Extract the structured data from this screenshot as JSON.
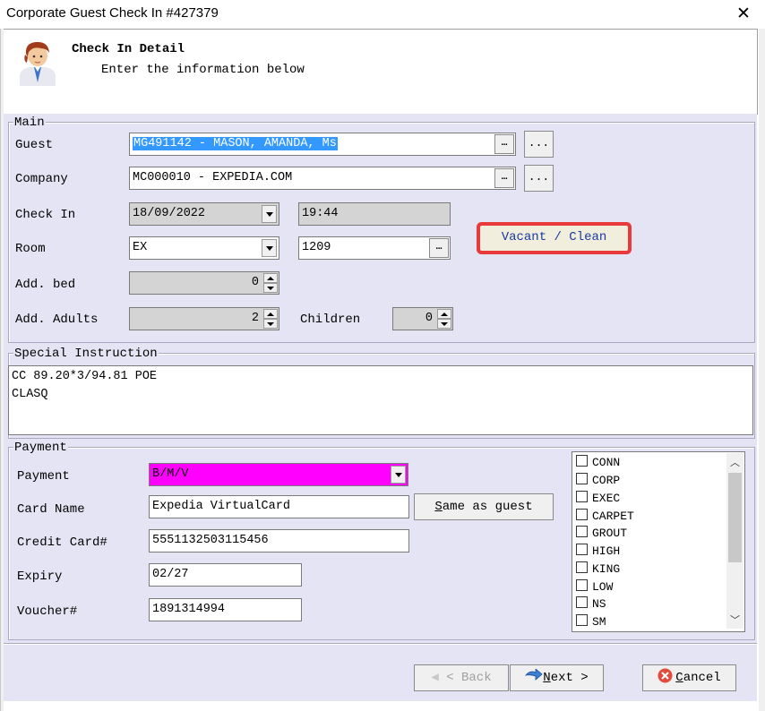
{
  "window": {
    "title": "Corporate Guest Check In #427379",
    "close_glyph": "✕"
  },
  "header": {
    "title": "Check In Detail",
    "subtitle": "Enter the information below",
    "icon": "user-avatar-icon"
  },
  "main": {
    "group_label": "Main",
    "guest": {
      "label": "Guest",
      "value": "MG491142 - MASON, AMANDA, Ms",
      "lookup_glyph": "…",
      "extra_button": "..."
    },
    "company": {
      "label": "Company",
      "value": "MC000010 - EXPEDIA.COM",
      "lookup_glyph": "…",
      "extra_button": "..."
    },
    "check_in": {
      "label": "Check In",
      "date": "18/09/2022",
      "time": "19:44"
    },
    "room": {
      "label": "Room",
      "type": "EX",
      "number": "1209",
      "lookup_glyph": "…"
    },
    "status": {
      "text": "Vacant / Clean",
      "highlight_color": "#e83a3a"
    },
    "add_bed": {
      "label": "Add. bed",
      "value": "0"
    },
    "add_adults": {
      "label": "Add. Adults",
      "value": "2"
    },
    "children": {
      "label": "Children",
      "value": "0"
    }
  },
  "special_instruction": {
    "group_label": "Special Instruction",
    "lines": [
      "CC 89.20*3/94.81 POE",
      "CLASQ"
    ]
  },
  "payment": {
    "group_label": "Payment",
    "payment": {
      "label": "Payment",
      "value": "B/M/V",
      "color": "#ff00ff"
    },
    "card_name": {
      "label": "Card Name",
      "value": "Expedia VirtualCard"
    },
    "same_as_guest": {
      "underlined": "S",
      "rest": "ame as guest"
    },
    "credit_card": {
      "label": "Credit Card#",
      "value": "5551132503115456"
    },
    "expiry": {
      "label": "Expiry",
      "value": "02/27"
    },
    "voucher": {
      "label": "Voucher#",
      "value": "1891314994"
    },
    "preferences": [
      "CONN",
      "CORP",
      "EXEC",
      "CARPET",
      "GROUT",
      "HIGH",
      "KING",
      "LOW",
      "NS",
      "SM"
    ]
  },
  "footer": {
    "back": {
      "text": "< Back",
      "underlined": "B"
    },
    "next": {
      "prefix": "",
      "underlined": "N",
      "rest": "ext >"
    },
    "cancel": {
      "underlined": "C",
      "rest": "ancel"
    }
  }
}
